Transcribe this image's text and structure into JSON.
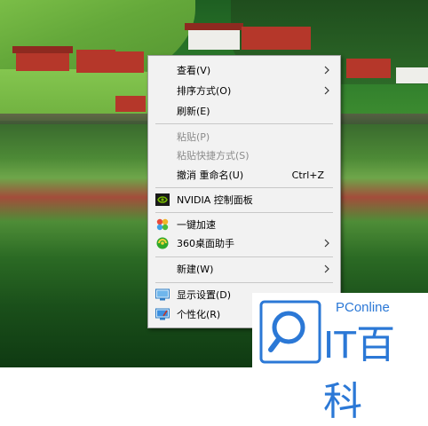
{
  "context_menu": {
    "items": [
      {
        "label": "查看(V)",
        "submenu": true
      },
      {
        "label": "排序方式(O)",
        "submenu": true
      },
      {
        "label": "刷新(E)"
      },
      {
        "label": "粘贴(P)",
        "disabled": true
      },
      {
        "label": "粘贴快捷方式(S)",
        "disabled": true
      },
      {
        "label": "撤消 重命名(U)",
        "shortcut": "Ctrl+Z"
      },
      {
        "label": "NVIDIA 控制面板",
        "icon": "nvidia-icon"
      },
      {
        "label": "一键加速",
        "icon": "speedup-icon"
      },
      {
        "label": "360桌面助手",
        "icon": "360-icon",
        "submenu": true
      },
      {
        "label": "新建(W)",
        "submenu": true
      },
      {
        "label": "显示设置(D)",
        "icon": "display-settings-icon"
      },
      {
        "label": "个性化(R)",
        "icon": "personalize-icon"
      }
    ]
  },
  "watermark": {
    "small_text": "PConline",
    "large_text": "IT百科",
    "brand_color": "#2b78d6"
  },
  "colors": {
    "menu_background": "#f2f2f2",
    "disabled_text": "#8b8b8b",
    "separator": "#c8c8c8"
  }
}
